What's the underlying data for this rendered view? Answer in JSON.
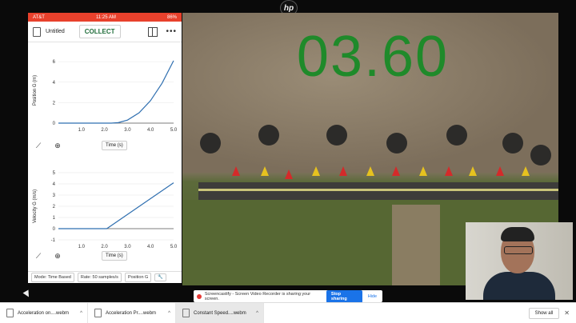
{
  "hp_logo": "hp",
  "phone": {
    "status": {
      "carrier": "AT&T",
      "time": "11:25 AM",
      "battery": "86%"
    },
    "doc_title": "Untitled",
    "collect_label": "COLLECT",
    "more": "•••",
    "graphs": [
      {
        "ylabel": "Position G (m)",
        "xlabel": "Time (s)",
        "y_ticks": [
          "6",
          "4",
          "2",
          "0"
        ],
        "x_ticks": [
          "1.0",
          "2.0",
          "3.0",
          "4.0",
          "5.0"
        ],
        "ylim": [
          0,
          6.4
        ],
        "xlim": [
          0,
          5
        ],
        "series": [
          [
            0,
            0
          ],
          [
            2.3,
            0
          ],
          [
            2.6,
            0.05
          ],
          [
            3.0,
            0.3
          ],
          [
            3.5,
            1.0
          ],
          [
            4.0,
            2.2
          ],
          [
            4.5,
            3.9
          ],
          [
            5.0,
            6.1
          ]
        ]
      },
      {
        "ylabel": "Velocity G (m/s)",
        "xlabel": "Time (s)",
        "y_ticks": [
          "5",
          "4",
          "3",
          "2",
          "1",
          "0",
          "-1"
        ],
        "x_ticks": [
          "1.0",
          "2.0",
          "3.0",
          "4.0",
          "5.0"
        ],
        "ylim": [
          -1,
          5
        ],
        "xlim": [
          0,
          5
        ],
        "series": [
          [
            0,
            0
          ],
          [
            2.1,
            0
          ],
          [
            5.0,
            4.1
          ]
        ]
      }
    ],
    "bottom": {
      "mode": "Mode: Time Based",
      "rate": "Rate: 50 samples/s",
      "sensor": "Position G"
    }
  },
  "video": {
    "timer": "03.60"
  },
  "share_bar": {
    "text": "Screencastify - Screen Video Recorder is sharing your screen.",
    "stop": "Stop sharing",
    "hide": "Hide"
  },
  "downloads": [
    {
      "name": "Acceleration on....webm"
    },
    {
      "name": "Acceleration Pr....webm"
    },
    {
      "name": "Constant Speed....webm"
    }
  ],
  "show_all": "Show all",
  "close": "✕",
  "colors": {
    "status_bar": "#e8412c",
    "plot_line": "#2f6fb0",
    "timer": "#1f8a2a",
    "accent": "#1a73e8"
  }
}
